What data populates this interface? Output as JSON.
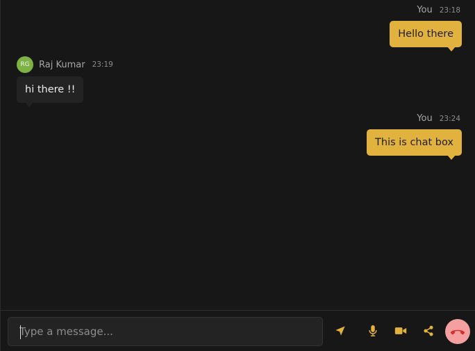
{
  "colors": {
    "accent": "#e2b23f",
    "background": "#171717",
    "incoming_bubble": "#232323",
    "avatar": "#7cb342",
    "end_call_bg": "#f4a0a0",
    "end_call_icon": "#d32f2f"
  },
  "messages": [
    {
      "direction": "outgoing",
      "sender": "You",
      "time": "23:18",
      "text": "Hello there"
    },
    {
      "direction": "incoming",
      "sender": "Raj Kumar",
      "initials": "RG",
      "time": "23:19",
      "text": "hi there !!"
    },
    {
      "direction": "outgoing",
      "sender": "You",
      "time": "23:24",
      "text": "This is chat box"
    }
  ],
  "composer": {
    "placeholder": "Type a message...",
    "value": "",
    "icons": {
      "send": "send-icon",
      "mic": "microphone-icon",
      "video": "video-camera-icon",
      "share": "share-icon",
      "end_call": "phone-hangup-icon"
    }
  }
}
